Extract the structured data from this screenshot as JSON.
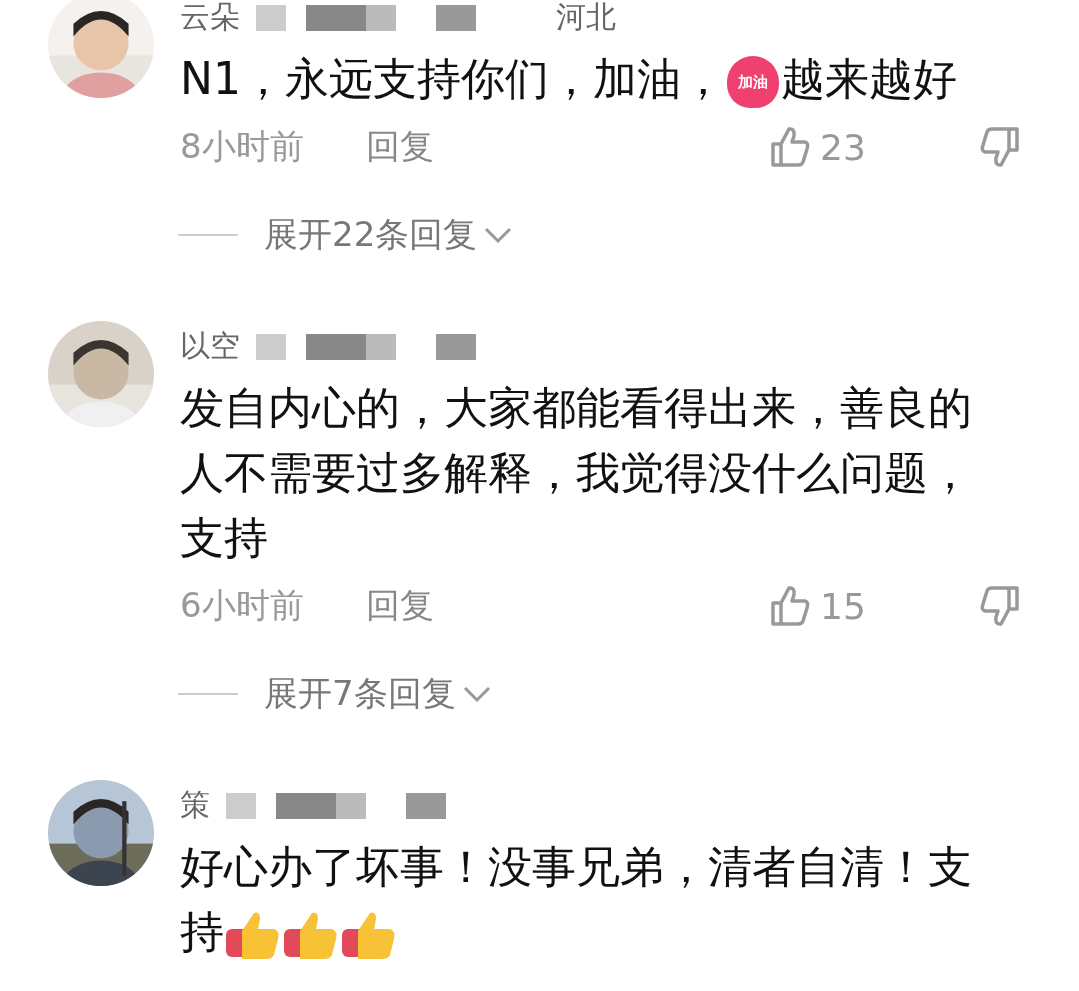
{
  "comments": [
    {
      "username": "云朵",
      "location": "河北",
      "avatar": {
        "kind": "picture"
      },
      "body": [
        {
          "kind": "text",
          "text": "N1，永远支持你们，加油，"
        },
        {
          "kind": "sticker",
          "text": "加油"
        },
        {
          "kind": "text",
          "text": "越来越好"
        }
      ],
      "time": "8小时前",
      "reply": "回复",
      "likes": "23",
      "replies_toggle": "展开22条回复"
    },
    {
      "username": "以空",
      "avatar": {
        "kind": "picture"
      },
      "body": [
        {
          "kind": "text",
          "text": "发自内心的，大家都能看得出来，善良的人不需要过多解释，我觉得没什么问题，支持"
        }
      ],
      "time": "6小时前",
      "reply": "回复",
      "likes": "15",
      "replies_toggle": "展开7条回复"
    },
    {
      "username": "策",
      "avatar": {
        "kind": "picture"
      },
      "body": [
        {
          "kind": "text",
          "text": "好心办了坏事！没事兄弟，清者自清！支持"
        },
        {
          "kind": "thumb"
        },
        {
          "kind": "thumb"
        },
        {
          "kind": "thumb"
        }
      ]
    }
  ]
}
